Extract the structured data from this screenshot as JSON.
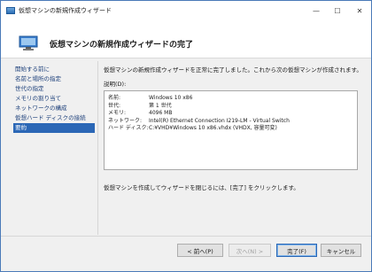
{
  "window": {
    "title": "仮想マシンの新規作成ウィザード",
    "controls": {
      "minimize": "—",
      "maximize": "☐",
      "close": "✕"
    }
  },
  "header": {
    "title": "仮想マシンの新規作成ウィザードの完了"
  },
  "sidebar": {
    "items": [
      {
        "label": "開始する前に",
        "active": false
      },
      {
        "label": "名前と場所の指定",
        "active": false
      },
      {
        "label": "世代の指定",
        "active": false
      },
      {
        "label": "メモリの割り当て",
        "active": false
      },
      {
        "label": "ネットワークの構成",
        "active": false
      },
      {
        "label": "仮想ハード ディスクの接続",
        "active": false
      },
      {
        "label": "要約",
        "active": true
      }
    ]
  },
  "content": {
    "lead": "仮想マシンの新規作成ウィザードを正常に完了しました。これから次の仮想マシンが作成されます。",
    "description_label": "説明(D):",
    "summary": [
      {
        "key": "名前:",
        "value": "Windows 10 x86"
      },
      {
        "key": "世代:",
        "value": "第 1 世代"
      },
      {
        "key": "メモリ:",
        "value": "4096 MB"
      },
      {
        "key": "ネットワーク:",
        "value": "Intel(R) Ethernet Connection I219-LM - Virtual Switch"
      },
      {
        "key": "ハード ディスク:",
        "value": "C:¥VHD¥Windows 10 x86.vhdx (VHDX, 容量可変)"
      }
    ],
    "finish_note": "仮想マシンを作成してウィザードを閉じるには、[完了] をクリックします。"
  },
  "buttons": {
    "previous": "< 前へ(P)",
    "next": "次へ(N) >",
    "finish": "完了(F)",
    "cancel": "キャンセル"
  },
  "colors": {
    "accent": "#2b67b6",
    "nav_text": "#1c3f7a"
  }
}
